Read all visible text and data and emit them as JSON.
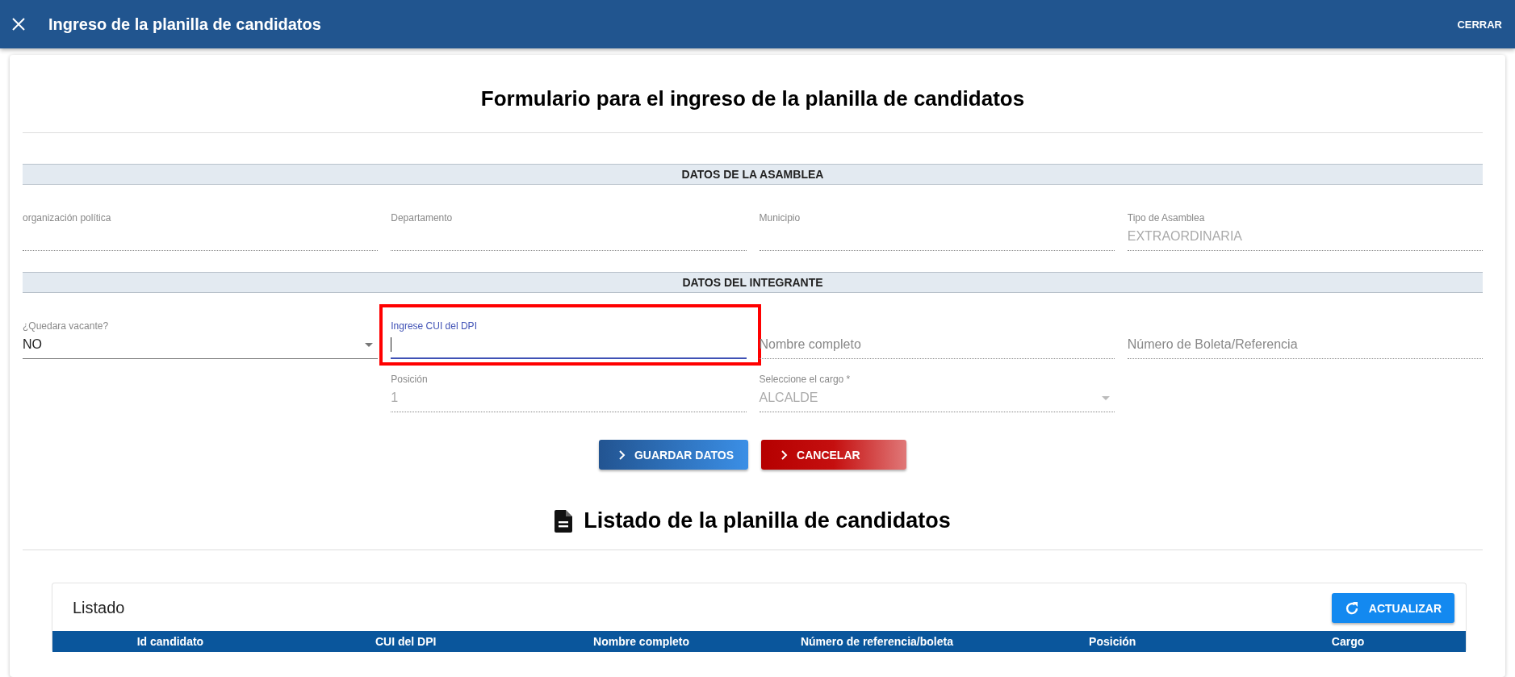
{
  "header": {
    "title": "Ingreso de la planilla de candidatos",
    "close_label": "CERRAR"
  },
  "form": {
    "title": "Formulario para el ingreso de la planilla de candidatos",
    "sections": [
      {
        "title": "DATOS DE LA ASAMBLEA",
        "lead_field": {
          "kind": "text",
          "label": "organización política",
          "disabled": true,
          "focused": false
        },
        "fields": [
          {
            "kind": "text",
            "label": "Departamento",
            "disabled": true,
            "focused": false
          },
          {
            "kind": "text",
            "label": "Municipio",
            "disabled": true,
            "focused": false
          },
          {
            "kind": "text",
            "label": "Tipo de Asamblea",
            "value": "EXTRAORDINARIA",
            "disabled": true,
            "focused": false
          }
        ]
      },
      {
        "title": "DATOS DEL INTEGRANTE",
        "lead_field": {
          "kind": "select",
          "label": "¿Quedara vacante?",
          "value": "NO",
          "disabled": false,
          "focused": false
        },
        "fields": [
          {
            "kind": "text",
            "label": "Ingrese CUI del DPI",
            "disabled": false,
            "focused": true,
            "highlighted": true
          },
          {
            "kind": "text",
            "placeholder": "Nombre completo",
            "disabled": true,
            "focused": false
          },
          {
            "kind": "text",
            "placeholder": "Número de Boleta/Referencia",
            "disabled": true,
            "focused": false
          },
          {
            "kind": "text",
            "label": "Posición",
            "value": "1",
            "disabled": true,
            "focused": false
          },
          {
            "kind": "select",
            "label": "Seleccione el cargo *",
            "value": "ALCALDE",
            "disabled": true,
            "focused": false
          }
        ]
      }
    ],
    "buttons": [
      {
        "label": "GUARDAR DATOS",
        "kind": "primary"
      },
      {
        "label": "CANCELAR",
        "kind": "danger"
      }
    ]
  },
  "listing": {
    "title": "Listado de la planilla de candidatos",
    "card_title": "Listado",
    "refresh_label": "ACTUALIZAR",
    "table": {
      "columns": [
        "Id candidato",
        "CUI del DPI",
        "Nombre completo",
        "Número de referencia/boleta",
        "Posición",
        "Cargo"
      ]
    }
  }
}
